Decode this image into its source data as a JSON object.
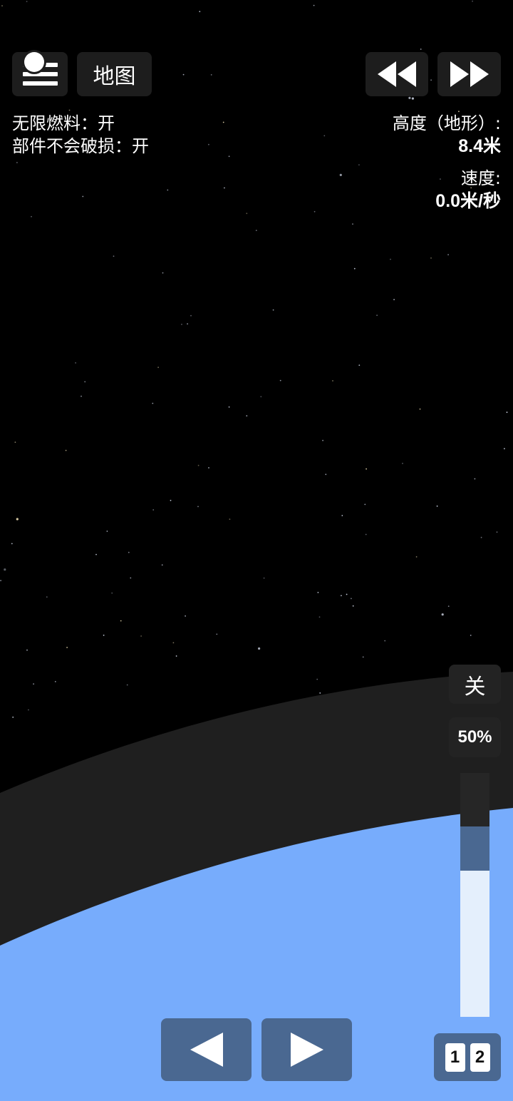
{
  "colors": {
    "space": "#000000",
    "atmosphere": "#1f1f1f",
    "planet": "#77acfc",
    "button": "#1d1d1d",
    "button_blue": "#4a6891",
    "throttle_fill": "#e4effc"
  },
  "toolbar": {
    "menu_icon": "hamburger-menu-icon",
    "map_label": "地图",
    "rewind_icon": "rewind-icon",
    "fast_forward_icon": "fast-forward-icon"
  },
  "cheats": {
    "infinite_fuel": "无限燃料：开",
    "unbreakable_parts": "部件不会破损：开"
  },
  "telemetry": {
    "altitude_label": "高度（地形）:",
    "altitude_value": "8.4米",
    "speed_label": "速度:",
    "speed_value": "0.0米/秒"
  },
  "controls": {
    "engine_toggle_label": "关",
    "throttle_percent_label": "50%",
    "throttle_level": 0.6,
    "rotate_left_icon": "arrow-left-icon",
    "rotate_right_icon": "arrow-right-icon",
    "stage_digits": [
      "1",
      "2"
    ]
  }
}
